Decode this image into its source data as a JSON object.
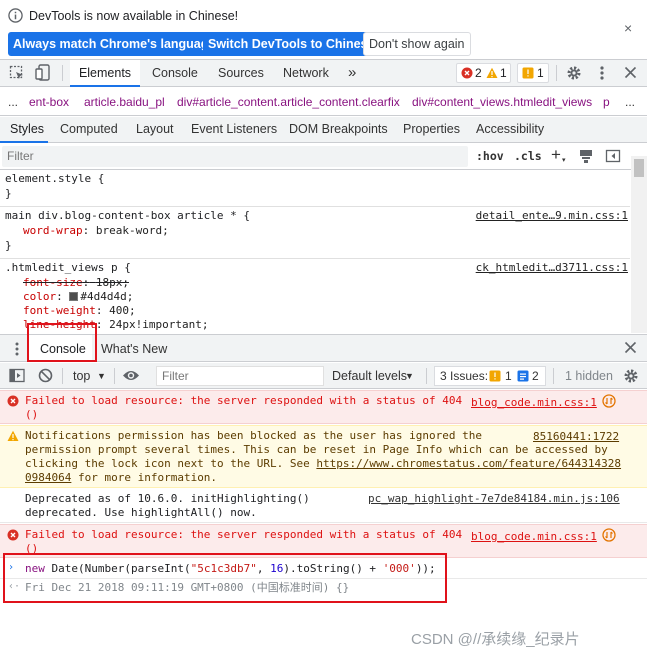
{
  "infobar": {
    "message": "DevTools is now available in Chinese!",
    "btn_match": "Always match Chrome's language",
    "btn_switch": "Switch DevTools to Chinese",
    "btn_dont_show": "Don't show again",
    "close": "×"
  },
  "toolbar": {
    "tabs": [
      "Elements",
      "Console",
      "Sources",
      "Network"
    ],
    "more": "»",
    "errors": "2",
    "warnings": "1",
    "issues": "1"
  },
  "breadcrumb": [
    "...",
    "ent-box",
    "article.baidu_pl",
    "div#article_content.article_content.clearfix",
    "div#content_views.htmledit_views",
    "p",
    "..."
  ],
  "subtabs": [
    "Styles",
    "Computed",
    "Layout",
    "Event Listeners",
    "DOM Breakpoints",
    "Properties",
    "Accessibility"
  ],
  "filter": {
    "placeholder": "Filter",
    "hov": ":hov",
    "cls": ".cls",
    "plus": "+"
  },
  "styles": {
    "r1_selector": "element.style {",
    "r1_close": "}",
    "r2_selector": "main div.blog-content-box article * {",
    "r2_source": "detail_ente…9.min.css:1",
    "r2_prop": "word-wrap",
    "r2_val": "break-word;",
    "r2_close": "}",
    "r3_selector": ".htmledit_views p {",
    "r3_source": "ck_htmledit…d3711.css:1",
    "r3_p1": "font-size",
    "r3_v1": "18px;",
    "r3_p2": "color",
    "r3_v2": "#4d4d4d;",
    "r3_p3": "font-weight",
    "r3_v3": "400;",
    "r3_p4": "line-height",
    "r3_v4": "24px!important;",
    "colon": ":"
  },
  "colors": {
    "swatch": "#4d4d4d",
    "accent": "#1a73e8",
    "highlight_box": "#e0121b"
  },
  "drawer": {
    "tab_console": "Console",
    "tab_whats_new": "What's New",
    "close": "×"
  },
  "console_toolbar": {
    "context": "top",
    "filter_placeholder": "Filter",
    "levels": "Default levels",
    "issues_label": "3 Issues:",
    "issues_warn": "1",
    "issues_info": "2",
    "hidden": "1 hidden"
  },
  "messages": {
    "m1_line1": "Failed to load resource: the server responded with a status of 404",
    "m1_line2": "()",
    "m1_src": "blog_code.min.css:1",
    "m2_line1": "Notifications permission has been blocked as the user has ignored the",
    "m2_line2": "permission prompt several times. This can be reset in Page Info which can be accessed by",
    "m2_line3_pre": "clicking the lock icon next to the URL. See ",
    "m2_line3_link": "https://www.chromestatus.com/feature/644314328",
    "m2_line4_link": "0984064",
    "m2_line4_post": " for more information.",
    "m2_src": "85160441:1722",
    "m3_line1": "Deprecated as of 10.6.0. initHighlighting()",
    "m3_line2": "deprecated.  Use highlightAll() now.",
    "m3_src": "pc_wap_highlight-7e7de84184.min.js:106",
    "m4_line1": "Failed to load resource: the server responded with a status of 404",
    "m4_line2": "()",
    "m4_src": "blog_code.min.css:1"
  },
  "input": {
    "kw_new": "new ",
    "date": "Date",
    "p1": "(",
    "number": "Number",
    "p2": "(parseInt(",
    "str1": "\"5c1c3db7\"",
    "comma": ", ",
    "num16": "16",
    "p3": ").toString() + ",
    "str2": "'000'",
    "p4": "));"
  },
  "result": {
    "text": "Fri Dec 21 2018 09:11:19 GMT+0800 (中国标准时间) {}"
  },
  "watermark": "CSDN @//承续缘_纪录片"
}
